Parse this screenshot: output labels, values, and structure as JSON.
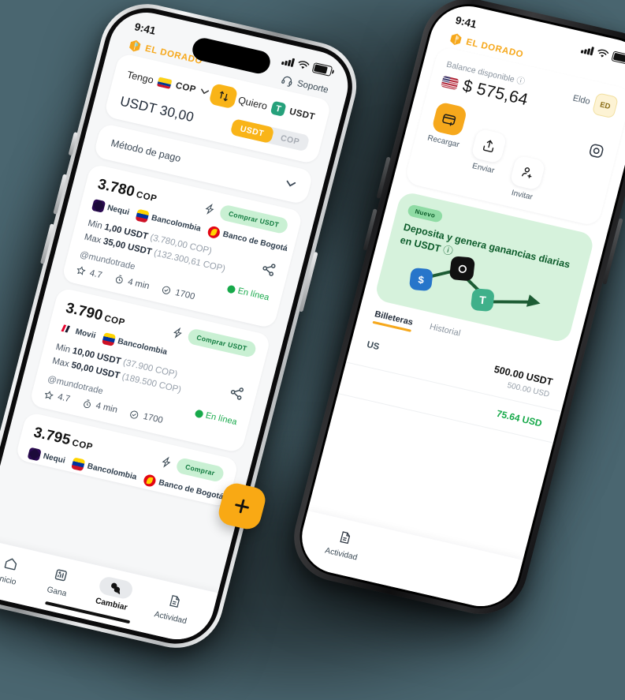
{
  "background_color": "#4a6670",
  "accent_colors": {
    "brand_orange": "#F6A81C",
    "fab_orange": "#F9A914",
    "green_pill_bg": "#c9f0d3",
    "green_pill_text": "#0f7a3d",
    "promo_bg": "#d6f2dc",
    "promo_text": "#0d5c2b",
    "online_green": "#17a94a",
    "tether_green": "#26A17B"
  },
  "brand": {
    "name": "EL DORADO",
    "mark_icon": "eldorado-logo-icon"
  },
  "phone_left": {
    "status_bar": {
      "time": "9:41",
      "icons": [
        "cellular-signal-icon",
        "wifi-icon",
        "battery-icon"
      ]
    },
    "header": {
      "support_label": "Soporte",
      "support_icon": "headset-icon"
    },
    "swap_card": {
      "have_label": "Tengo",
      "have_currency": "COP",
      "have_flag_icon": "colombia-flag-icon",
      "have_chevron_icon": "chevron-down-icon",
      "swap_icon": "swap-vertical-icon",
      "want_label": "Quiero",
      "want_currency": "USDT",
      "want_icon": "tether-icon",
      "amount": "USDT 30,00",
      "toggle": {
        "options": [
          "USDT",
          "COP"
        ],
        "selected": "USDT"
      }
    },
    "payment_method": {
      "label": "Método de pago",
      "chevron_icon": "chevron-down-icon"
    },
    "offers": [
      {
        "price": "3.780",
        "currency": "COP",
        "flash_icon": "lightning-icon",
        "buy_label": "Comprar USDT",
        "banks": [
          {
            "name": "Nequi",
            "icon": "nequi-icon"
          },
          {
            "name": "Bancolombia",
            "icon": "bancolombia-icon"
          },
          {
            "name": "Banco de Bogotá",
            "icon": "banco-de-bogota-icon"
          }
        ],
        "min_label": "Min",
        "min_value": "1,00 USDT",
        "min_converted": "(3.780,00 COP)",
        "max_label": "Max",
        "max_value": "35,00 USDT",
        "max_converted": "(132.300,61 COP)",
        "share_icon": "share-icon",
        "user": "@mundotrade",
        "status": "En línea",
        "status_icon": "online-check-icon",
        "rating": "4.7",
        "rating_icon": "star-icon",
        "time": "4 min",
        "time_icon": "stopwatch-icon",
        "trades": "1700",
        "trades_icon": "check-circle-icon"
      },
      {
        "price": "3.790",
        "currency": "COP",
        "flash_icon": "lightning-icon",
        "buy_label": "Comprar USDT",
        "banks": [
          {
            "name": "Movii",
            "icon": "movii-icon"
          },
          {
            "name": "Bancolombia",
            "icon": "bancolombia-icon"
          }
        ],
        "min_label": "Min",
        "min_value": "10,00 USDT",
        "min_converted": "(37.900 COP)",
        "max_label": "Max",
        "max_value": "50,00 USDT",
        "max_converted": "(189.500 COP)",
        "share_icon": "share-icon",
        "user": "@mundotrade",
        "status": "En línea",
        "status_icon": "online-check-icon",
        "rating": "4.7",
        "rating_icon": "star-icon",
        "time": "4 min",
        "time_icon": "stopwatch-icon",
        "trades": "1700",
        "trades_icon": "check-circle-icon"
      },
      {
        "price": "3.795",
        "currency": "COP",
        "flash_icon": "lightning-icon",
        "buy_label": "Comprar",
        "banks": [
          {
            "name": "Nequi",
            "icon": "nequi-icon"
          },
          {
            "name": "Bancolombia",
            "icon": "bancolombia-icon"
          },
          {
            "name": "Banco de Bogotá",
            "icon": "banco-de-bogota-icon"
          }
        ]
      }
    ],
    "fab": {
      "icon": "plus-icon"
    },
    "tabbar": [
      {
        "label": "Inicio",
        "icon": "home-icon",
        "active": false
      },
      {
        "label": "Gana",
        "icon": "chart-dollar-icon",
        "active": false
      },
      {
        "label": "Cambiar",
        "icon": "exchange-icon",
        "active": true
      },
      {
        "label": "Actividad",
        "icon": "document-icon",
        "active": false
      }
    ]
  },
  "phone_right": {
    "status_bar": {
      "time": "9:41",
      "icons": [
        "cellular-signal-icon",
        "wifi-icon",
        "battery-icon"
      ]
    },
    "balance": {
      "label": "Balance disponible",
      "info_icon": "info-icon",
      "flag_icon": "usa-flag-icon",
      "value": "$ 575,64",
      "account_label": "Eldo",
      "account_badge": "ED"
    },
    "actions": [
      {
        "label": "Recargar",
        "icon": "card-add-icon",
        "primary": true
      },
      {
        "label": "Enviar",
        "icon": "send-up-icon",
        "primary": false
      },
      {
        "label": "Invitar",
        "icon": "user-add-icon",
        "primary": false
      }
    ],
    "scan_icon": "scan-qr-icon",
    "promo": {
      "badge": "Nuevo",
      "text": "Deposita y genera ganancias diarias en USDT",
      "info_icon": "info-icon",
      "art_icons": [
        "usdc-coin-icon",
        "swap-arrow-icon",
        "tether-icon",
        "eldorado-black-icon"
      ]
    },
    "tabs": [
      {
        "label": "Billeteras",
        "active": true
      },
      {
        "label": "Historial",
        "active": false
      }
    ],
    "wallets": [
      {
        "label": "US",
        "amount": "500.00 USDT",
        "sub": "500.00 USD"
      },
      {
        "label": "",
        "amount": "75.64 USD",
        "sub": ""
      }
    ],
    "tabbar": [
      {
        "label": "Actividad",
        "icon": "document-icon",
        "active": false
      }
    ]
  }
}
